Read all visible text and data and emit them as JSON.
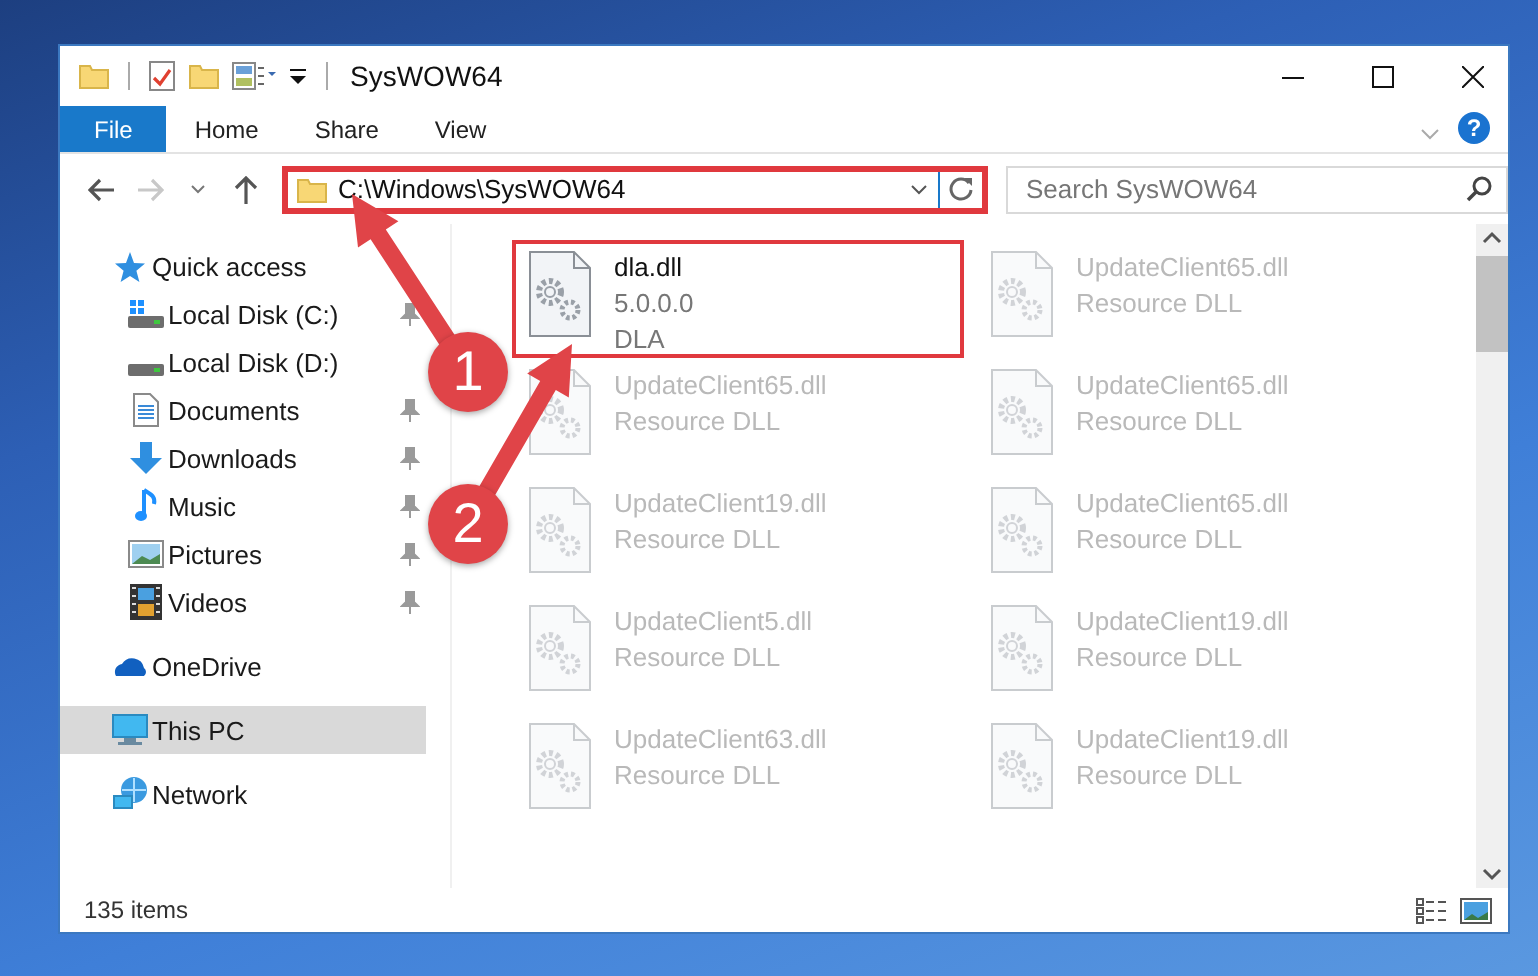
{
  "window": {
    "title": "SysWOW64"
  },
  "ribbon": {
    "tabs": [
      {
        "label": "File",
        "selected": true
      },
      {
        "label": "Home",
        "selected": false
      },
      {
        "label": "Share",
        "selected": false
      },
      {
        "label": "View",
        "selected": false
      }
    ],
    "help": "?"
  },
  "navigation": {
    "back_enabled": true,
    "forward_enabled": false
  },
  "address_bar": {
    "path": "C:\\Windows\\SysWOW64",
    "highlighted": true
  },
  "search": {
    "placeholder": "Search SysWOW64"
  },
  "sidebar": {
    "items": [
      {
        "label": "Quick access",
        "kind": "star",
        "selected": false,
        "children": [
          {
            "label": "Local Disk (C:)",
            "kind": "system-drive",
            "pinned": true,
            "selected": false
          },
          {
            "label": "Local Disk (D:)",
            "kind": "drive",
            "pinned": false,
            "selected": false
          },
          {
            "label": "Documents",
            "kind": "documents",
            "pinned": true,
            "selected": false
          },
          {
            "label": "Downloads",
            "kind": "downloads",
            "pinned": true,
            "selected": false
          },
          {
            "label": "Music",
            "kind": "music",
            "pinned": true,
            "selected": false
          },
          {
            "label": "Pictures",
            "kind": "pictures",
            "pinned": true,
            "selected": false
          },
          {
            "label": "Videos",
            "kind": "videos",
            "pinned": true,
            "selected": false
          }
        ]
      },
      {
        "label": "OneDrive",
        "kind": "cloud",
        "selected": false
      },
      {
        "label": "This PC",
        "kind": "computer",
        "selected": true
      },
      {
        "label": "Network",
        "kind": "network",
        "selected": false
      }
    ]
  },
  "files": [
    {
      "name": "dla.dll",
      "detail_1": "5.0.0.0",
      "detail_2": "DLA",
      "highlighted": true,
      "blurred": false
    },
    {
      "name": "UpdateClient65.dll",
      "detail_1": "Resource DLL",
      "highlighted": false,
      "blurred": true
    },
    {
      "name": "UpdateClient65.dll",
      "detail_1": "Resource DLL",
      "highlighted": false,
      "blurred": true
    },
    {
      "name": "UpdateClient65.dll",
      "detail_1": "Resource DLL",
      "highlighted": false,
      "blurred": true
    },
    {
      "name": "UpdateClient19.dll",
      "detail_1": "Resource DLL",
      "highlighted": false,
      "blurred": true
    },
    {
      "name": "UpdateClient65.dll",
      "detail_1": "Resource DLL",
      "highlighted": false,
      "blurred": true
    },
    {
      "name": "UpdateClient5.dll",
      "detail_1": "Resource DLL",
      "highlighted": false,
      "blurred": true
    },
    {
      "name": "UpdateClient19.dll",
      "detail_1": "Resource DLL",
      "highlighted": false,
      "blurred": true
    },
    {
      "name": "UpdateClient63.dll",
      "detail_1": "Resource DLL",
      "highlighted": false,
      "blurred": true
    },
    {
      "name": "UpdateClient19.dll",
      "detail_1": "Resource DLL",
      "highlighted": false,
      "blurred": true
    }
  ],
  "status_bar": {
    "item_count": "135 items"
  },
  "annotations": [
    {
      "label": "1"
    },
    {
      "label": "2"
    }
  ]
}
